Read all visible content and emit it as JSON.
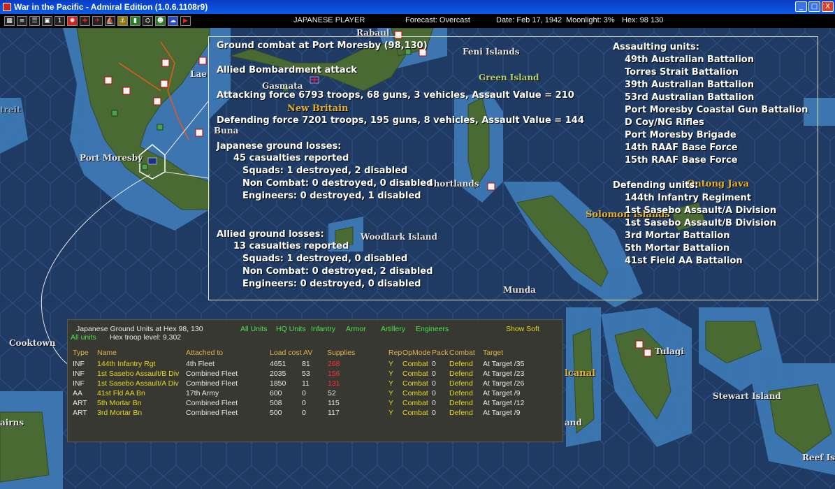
{
  "window": {
    "title": "War in the Pacific - Admiral Edition (1.0.6.1108r9)",
    "min_glyph": "_",
    "max_glyph": "□",
    "close_glyph": "X"
  },
  "toolbar": {
    "icons": [
      "report-icon",
      "document-icon",
      "list-icon",
      "unit-icon",
      "info-icon",
      "flag-icon",
      "cross-icon",
      "plane-icon",
      "ship-icon",
      "base-icon",
      "chart-icon",
      "group-icon",
      "pilot-icon",
      "cloud-icon",
      "end-turn-icon"
    ],
    "player": "JAPANESE PLAYER",
    "forecast": "Forecast: Overcast",
    "date": "Date: Feb 17, 1942",
    "moonlight": "Moonlight: 3%",
    "hex": "Hex: 98 130"
  },
  "map_labels": {
    "rabaul": "Rabaul",
    "feni": "Feni Islands",
    "green_island": "Green Island",
    "lae": "Lae",
    "gasmata": "Gasmata",
    "new_britain": "New Britain",
    "buna": "Buna",
    "port_moresby": "Port Moresby",
    "shortlands": "Shortlands",
    "ontong_java": "Ontong Java",
    "solomon": "Solomon Islands",
    "woodlark": "Woodlark Island",
    "munda": "Munda",
    "tulagi": "Tulagi",
    "cooktown": "Cooktown",
    "canal": "lcanal",
    "stewart": "Stewart Island",
    "reef": "Reef Isl",
    "cairns": "airns",
    "west_frag": "treit",
    "and_frag": "and"
  },
  "combat_report": {
    "title": "Ground combat at Port Moresby (98,130)",
    "attack_type": "Allied Bombardment attack",
    "attacking": "Attacking force 6793 troops, 68 guns, 3 vehicles, Assault Value = 210",
    "defending": "Defending force 7201 troops, 195 guns, 8 vehicles, Assault Value = 144",
    "jp_losses_header": "Japanese ground losses:",
    "jp_casualties": "45 casualties reported",
    "jp_squads": "Squads: 1 destroyed, 2 disabled",
    "jp_noncombat": "Non Combat: 0 destroyed, 0 disabled",
    "jp_engineers": "Engineers: 0 destroyed, 1 disabled",
    "al_losses_header": "Allied ground losses:",
    "al_casualties": "13 casualties reported",
    "al_squads": "Squads: 1 destroyed, 0 disabled",
    "al_noncombat": "Non Combat: 0 destroyed, 2 disabled",
    "al_engineers": "Engineers: 0 destroyed, 0 disabled",
    "assaulting_header": "Assaulting units:",
    "assaulting": [
      "49th Australian Battalion",
      "Torres Strait Battalion",
      "39th Australian Battalion",
      "53rd Australian Battalion",
      "Port Moresby Coastal Gun Battalion",
      "D Coy/NG Rifles",
      "Port Moresby Brigade",
      "14th RAAF Base Force",
      "15th RAAF Base Force"
    ],
    "defending_header": "Defending units:",
    "defending_units": [
      "144th Infantry Regiment",
      "1st Sasebo Assault/A Division",
      "1st Sasebo Assault/B Division",
      "3rd Mortar Battalion",
      "5th Mortar Battalion",
      "41st Field AA Battalion"
    ]
  },
  "unit_panel": {
    "title": "Japanese Ground Units at Hex 98, 130",
    "all_units_link": "All units",
    "troop_level": "Hex troop level: 9,302",
    "filters": [
      "All Units",
      "HQ Units",
      "Infantry",
      "Armor",
      "Artillery",
      "Engineers"
    ],
    "show_soft": "Show Soft",
    "headers": {
      "type": "Type",
      "name": "Name",
      "attached": "Attached to",
      "load": "Load cost",
      "av": "AV",
      "supplies": "Supplies",
      "rep": "Rep",
      "opmode": "OpMode",
      "pack": "Pack",
      "combat": "Combat",
      "target": "Target"
    },
    "rows": [
      {
        "type": "INF",
        "name": "144th Infantry Rgt",
        "attached": "4th Fleet",
        "load": "4651",
        "av": "81",
        "supplies": "268",
        "supplies_low": true,
        "rep": "Y",
        "opmode": "Combat",
        "pack": "0",
        "combat": "Defend",
        "target": "At Target /35"
      },
      {
        "type": "INF",
        "name": "1st Sasebo Assault/B Div",
        "attached": "Combined Fleet",
        "load": "2035",
        "av": "53",
        "supplies": "156",
        "supplies_low": true,
        "rep": "Y",
        "opmode": "Combat",
        "pack": "0",
        "combat": "Defend",
        "target": "At Target /23"
      },
      {
        "type": "INF",
        "name": "1st Sasebo Assault/A Div",
        "attached": "Combined Fleet",
        "load": "1850",
        "av": "11",
        "supplies": "131",
        "supplies_low": true,
        "rep": "Y",
        "opmode": "Combat",
        "pack": "0",
        "combat": "Defend",
        "target": "At Target /26"
      },
      {
        "type": "AA",
        "name": "41st Fld AA Bn",
        "attached": "17th Army",
        "load": "600",
        "av": "0",
        "supplies": "52",
        "supplies_low": false,
        "rep": "Y",
        "opmode": "Combat",
        "pack": "0",
        "combat": "Defend",
        "target": "At Target /9"
      },
      {
        "type": "ART",
        "name": "5th Mortar Bn",
        "attached": "Combined Fleet",
        "load": "508",
        "av": "0",
        "supplies": "115",
        "supplies_low": false,
        "rep": "Y",
        "opmode": "Combat",
        "pack": "0",
        "combat": "Defend",
        "target": "At Target /12"
      },
      {
        "type": "ART",
        "name": "3rd Mortar Bn",
        "attached": "Combined Fleet",
        "load": "500",
        "av": "0",
        "supplies": "117",
        "supplies_low": false,
        "rep": "Y",
        "opmode": "Combat",
        "pack": "0",
        "combat": "Defend",
        "target": "At Target /9"
      }
    ]
  },
  "colors": {
    "ocean": "#1f3a63",
    "shallow": "#3f7cb8",
    "land": "#4a6a34",
    "title_bar": "#0b5ce8",
    "link_green": "#4ee34e",
    "unit_yellow": "#e6d81f",
    "low_supply": "#ff3030"
  }
}
